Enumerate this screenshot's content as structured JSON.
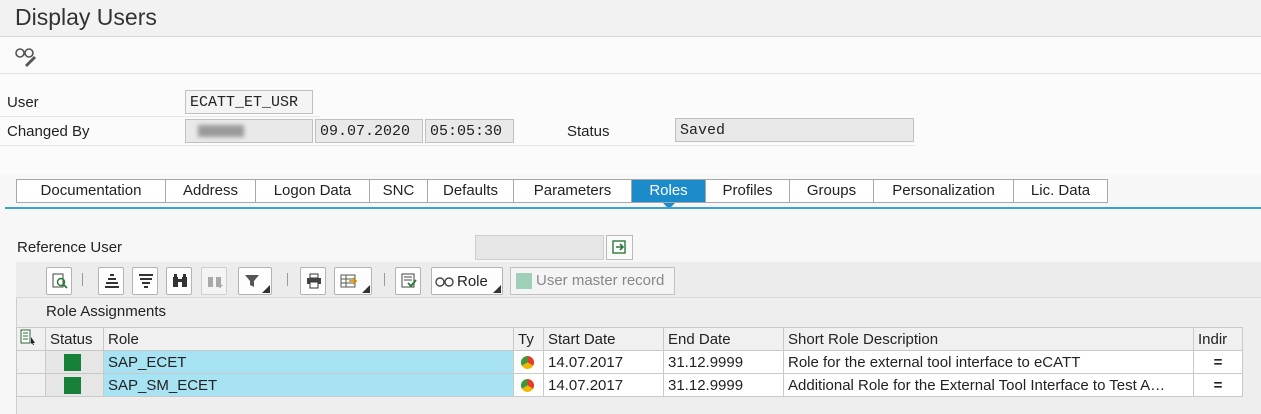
{
  "window": {
    "title": "Display Users"
  },
  "appbar": {
    "display_icon": "glasses-pencil-icon"
  },
  "header": {
    "user_label": "User",
    "user_value": "ECATT_ET_USR",
    "changed_by_label": "Changed By",
    "changed_date": "09.07.2020",
    "changed_time": "05:05:30",
    "status_label": "Status",
    "status_value": "Saved"
  },
  "tabs": [
    {
      "label": "Documentation",
      "active": false
    },
    {
      "label": "Address",
      "active": false
    },
    {
      "label": "Logon Data",
      "active": false
    },
    {
      "label": "SNC",
      "active": false
    },
    {
      "label": "Defaults",
      "active": false
    },
    {
      "label": "Parameters",
      "active": false
    },
    {
      "label": "Roles",
      "active": true
    },
    {
      "label": "Profiles",
      "active": false
    },
    {
      "label": "Groups",
      "active": false
    },
    {
      "label": "Personalization",
      "active": false
    },
    {
      "label": "Lic. Data",
      "active": false
    }
  ],
  "reference_user": {
    "label": "Reference User",
    "value": ""
  },
  "toolbar": {
    "role_button_label": "Role",
    "user_master_label": "User master record"
  },
  "grid": {
    "title": "Role Assignments",
    "columns": [
      "Status",
      "Role",
      "Ty",
      "Start Date",
      "End Date",
      "Short Role Description",
      "Indir"
    ],
    "rows": [
      {
        "status": "green",
        "role": "SAP_ECET",
        "type": "composite-pie-icon",
        "start": "14.07.2017",
        "end": "31.12.9999",
        "desc": "Role for the external tool interface to eCATT",
        "indirect": "="
      },
      {
        "status": "green",
        "role": "SAP_SM_ECET",
        "type": "composite-pie-icon",
        "start": "14.07.2017",
        "end": "31.12.9999",
        "desc": "Additional Role for the External Tool Interface to Test A…",
        "indirect": "="
      }
    ]
  },
  "colors": {
    "accent": "#1b8cc9",
    "status_green": "#17813a",
    "selection": "#a8e3f3"
  }
}
